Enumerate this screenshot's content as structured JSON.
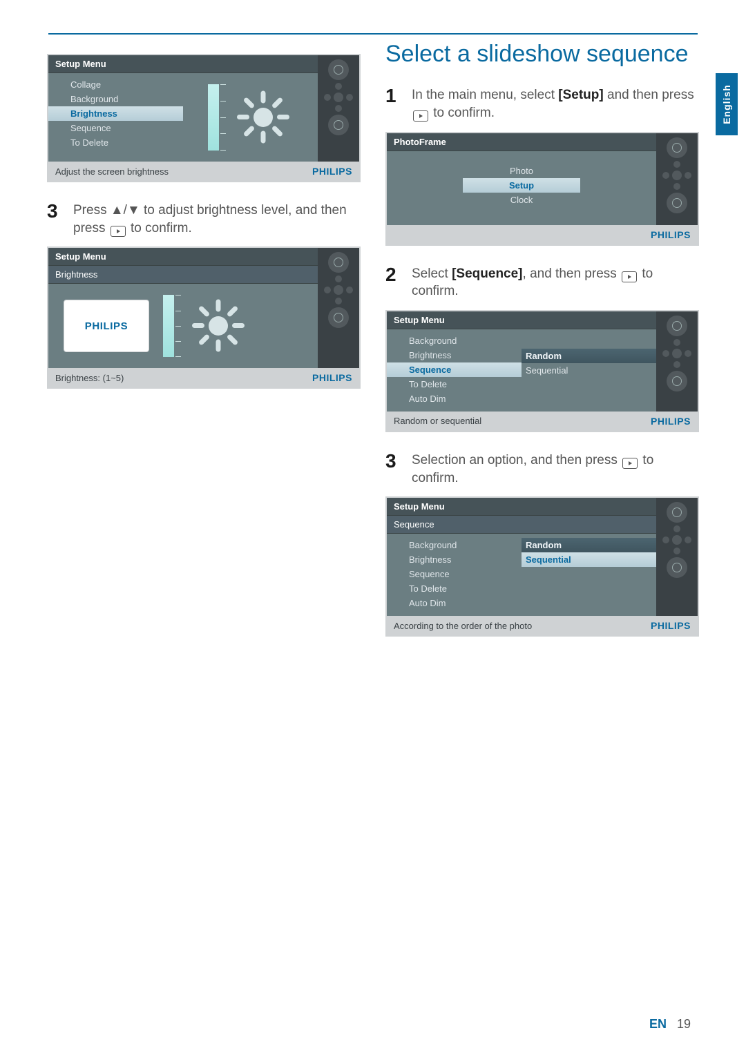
{
  "lang_tab": "English",
  "footer": {
    "lang": "EN",
    "page": "19"
  },
  "left": {
    "device1": {
      "title": "Setup Menu",
      "items": [
        "Collage",
        "Background",
        "Brightness",
        "Sequence",
        "To Delete"
      ],
      "selected": "Brightness",
      "hint": "Adjust the screen brightness",
      "brand": "PHILIPS"
    },
    "step3_a": "Press ",
    "step3_b": " to adjust brightness level, and then press ",
    "step3_c": " to confirm.",
    "arrows": "▲/▼",
    "device2": {
      "title": "Setup Menu",
      "subtitle": "Brightness",
      "logo": "PHILIPS",
      "hint": "Brightness: (1~5)",
      "brand": "PHILIPS"
    }
  },
  "right": {
    "heading": "Select a slideshow sequence",
    "step1_a": "In the main menu, select ",
    "step1_bold": "[Setup]",
    "step1_b": " and then press ",
    "step1_c": " to confirm.",
    "device1": {
      "title": "PhotoFrame",
      "items": [
        "Photo",
        "Setup",
        "Clock"
      ],
      "selected": "Setup",
      "brand": "PHILIPS"
    },
    "step2_a": "Select ",
    "step2_bold": "[Sequence]",
    "step2_b": ", and then press ",
    "step2_c": " to confirm.",
    "device2": {
      "title": "Setup Menu",
      "left_items": [
        "Background",
        "Brightness",
        "Sequence",
        "To Delete",
        "Auto Dim"
      ],
      "left_selected": "Sequence",
      "right_items": [
        "Random",
        "Sequential"
      ],
      "right_selected": "Random",
      "hint": "Random or sequential",
      "brand": "PHILIPS"
    },
    "step3_a": "Selection an option, and then press ",
    "step3_b": " to confirm.",
    "device3": {
      "title": "Setup Menu",
      "subtitle": "Sequence",
      "left_items": [
        "Background",
        "Brightness",
        "Sequence",
        "To Delete",
        "Auto Dim"
      ],
      "right_items": [
        "Random",
        "Sequential"
      ],
      "right_selected": "Sequential",
      "hint": "According to the order of the photo",
      "brand": "PHILIPS"
    }
  }
}
